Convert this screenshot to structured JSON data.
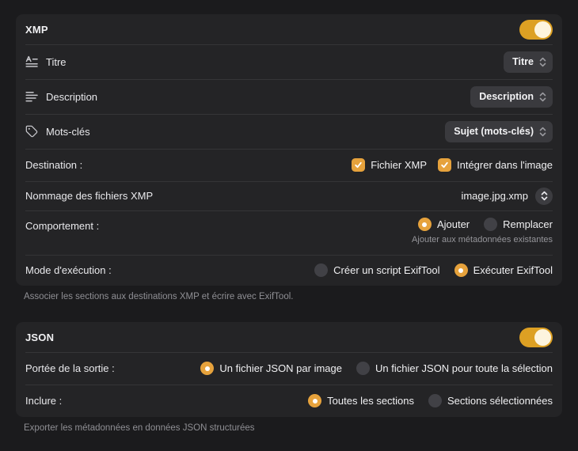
{
  "colors": {
    "accent": "#e6a23c",
    "toggle_track": "#dda023",
    "toggle_knob": "#fdf4de"
  },
  "xmp": {
    "title": "XMP",
    "enabled": true,
    "rows": {
      "titre": {
        "label": "Titre",
        "icon": "textformat-icon",
        "value": "Titre"
      },
      "description": {
        "label": "Description",
        "icon": "text-lines-icon",
        "value": "Description"
      },
      "mots_cles": {
        "label": "Mots-clés",
        "icon": "tag-icon",
        "value": "Sujet (mots-clés)"
      },
      "destination": {
        "label": "Destination :",
        "checkboxes": [
          {
            "label": "Fichier XMP",
            "checked": true
          },
          {
            "label": "Intégrer dans l'image",
            "checked": true
          }
        ]
      },
      "nommage": {
        "label": "Nommage des fichiers XMP",
        "value": "image.jpg.xmp"
      },
      "comportement": {
        "label": "Comportement :",
        "options": [
          {
            "label": "Ajouter",
            "selected": true
          },
          {
            "label": "Remplacer",
            "selected": false
          }
        ],
        "helper": "Ajouter aux métadonnées existantes"
      },
      "mode": {
        "label": "Mode d'exécution :",
        "options": [
          {
            "label": "Créer un script ExifTool",
            "selected": false
          },
          {
            "label": "Exécuter ExifTool",
            "selected": true
          }
        ]
      }
    },
    "footer": "Associer les sections aux destinations XMP et écrire avec ExifTool."
  },
  "json": {
    "title": "JSON",
    "enabled": true,
    "rows": {
      "portee": {
        "label": "Portée de la sortie :",
        "options": [
          {
            "label": "Un fichier JSON par image",
            "selected": true
          },
          {
            "label": "Un fichier JSON pour toute la sélection",
            "selected": false
          }
        ]
      },
      "inclure": {
        "label": "Inclure :",
        "options": [
          {
            "label": "Toutes les sections",
            "selected": true
          },
          {
            "label": "Sections sélectionnées",
            "selected": false
          }
        ]
      }
    },
    "footer": "Exporter les métadonnées en données JSON structurées"
  }
}
